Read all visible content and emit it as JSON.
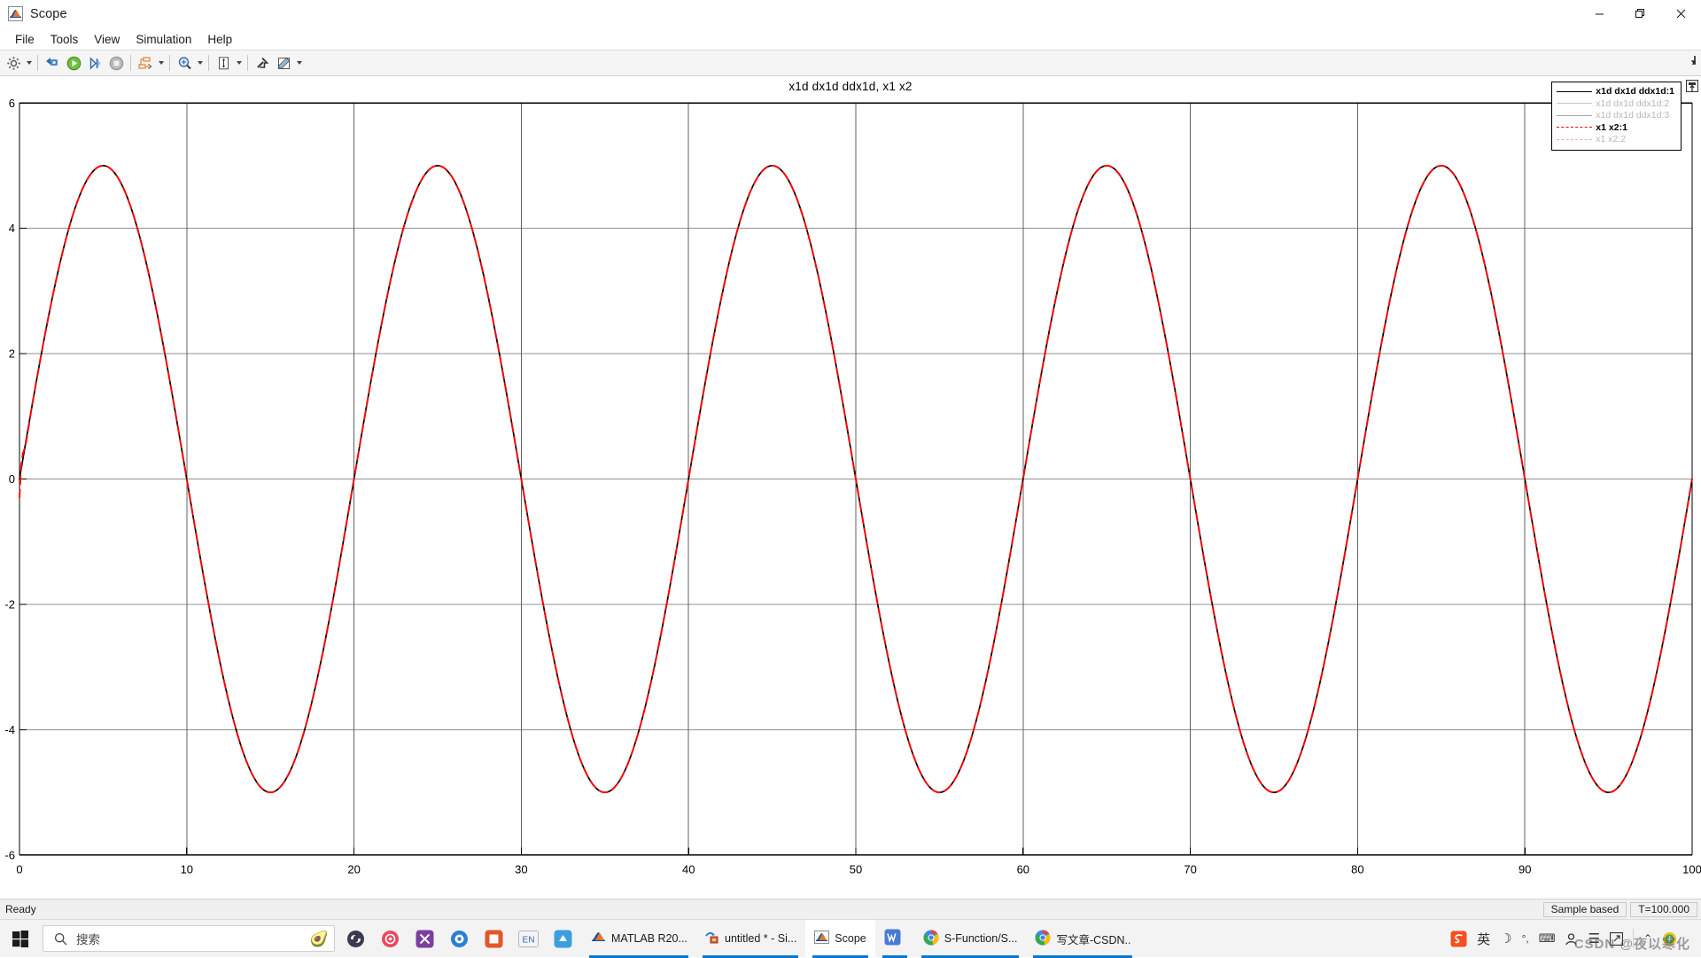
{
  "window": {
    "title": "Scope",
    "app_icon": "matlab-scope-icon",
    "controls": {
      "minimize": "minimize-icon",
      "restore": "restore-icon",
      "close": "close-icon"
    }
  },
  "menubar": {
    "items": [
      {
        "label": "File",
        "name": "menu-file"
      },
      {
        "label": "Tools",
        "name": "menu-tools"
      },
      {
        "label": "View",
        "name": "menu-view"
      },
      {
        "label": "Simulation",
        "name": "menu-simulation"
      },
      {
        "label": "Help",
        "name": "menu-help"
      }
    ]
  },
  "toolbar": {
    "buttons": [
      {
        "name": "configuration-properties-button",
        "icon": "gear-icon",
        "has_dropdown": true
      },
      {
        "name": "sim-restart-button",
        "icon": "rewind-camera-icon",
        "has_dropdown": false
      },
      {
        "name": "run-button",
        "icon": "play-icon",
        "has_dropdown": false
      },
      {
        "name": "step-forward-button",
        "icon": "step-forward-icon",
        "has_dropdown": false
      },
      {
        "name": "stop-button",
        "icon": "stop-icon",
        "has_dropdown": false
      },
      {
        "name": "signal-selection-button",
        "icon": "signal-selector-icon",
        "has_dropdown": true
      },
      {
        "name": "zoom-button",
        "icon": "zoom-in-icon",
        "has_dropdown": true
      },
      {
        "name": "autoscale-button",
        "icon": "autoscale-icon",
        "has_dropdown": true
      },
      {
        "name": "cursor-measurements-button",
        "icon": "cursor-measurement-icon",
        "has_dropdown": false
      },
      {
        "name": "style-button",
        "icon": "pencil-style-icon",
        "has_dropdown": true
      }
    ],
    "right_icon": "dock-arrow-icon"
  },
  "plot": {
    "title": "x1d   dx1d   ddx1d, x1 x2",
    "legend_icon": "legend-resize-icon"
  },
  "chart_data": {
    "type": "line",
    "title": "x1d   dx1d   ddx1d, x1 x2",
    "xlabel": "",
    "ylabel": "",
    "xlim": [
      0,
      100
    ],
    "ylim": [
      -6,
      6
    ],
    "xticks": [
      0,
      10,
      20,
      30,
      40,
      50,
      60,
      70,
      80,
      90,
      100
    ],
    "yticks": [
      -6,
      -4,
      -2,
      0,
      2,
      4,
      6
    ],
    "grid": true,
    "legend_position": "top-right",
    "legend": [
      {
        "label": "x1d   dx1d   ddx1d:1",
        "color": "#000000",
        "style": "solid",
        "width": 1.6,
        "visible": true
      },
      {
        "label": "x1d   dx1d   ddx1d:2",
        "color": "#c8c8c8",
        "style": "solid",
        "width": 1.2,
        "visible": false
      },
      {
        "label": "x1d   dx1d   ddx1d:3",
        "color": "#a6a6a6",
        "style": "solid",
        "width": 1.2,
        "visible": false
      },
      {
        "label": "x1 x2:1",
        "color": "#ff0000",
        "style": "dashed",
        "width": 1.8,
        "visible": true
      },
      {
        "label": "x1 x2:2",
        "color": "#ffaaaa",
        "style": "dashed",
        "width": 1.4,
        "visible": false
      }
    ],
    "series": [
      {
        "name": "x1d   dx1d   ddx1d:1",
        "color": "#000000",
        "style": "solid",
        "formula": "5*sin(2*pi*x/20)",
        "amplitude": 5,
        "period": 20,
        "phase": 0,
        "samples": 1001
      },
      {
        "name": "x1 x2:1",
        "color": "#ff0000",
        "style": "dashed",
        "formula": "5*sin(2*pi*x/20)",
        "amplitude": 5,
        "period": 20,
        "phase": 0,
        "samples": 1001,
        "startup_transient": true
      }
    ]
  },
  "statusbar": {
    "ready_text": "Ready",
    "sample_mode": "Sample based",
    "time": "T=100.000"
  },
  "taskbar": {
    "start_icon": "windows-start-icon",
    "search": {
      "placeholder": "搜索",
      "icon": "search-icon",
      "extra_icon": "avocado-icon"
    },
    "pinned": [
      {
        "name": "taskbar-icon-sogou-cloud",
        "glyph": "S"
      },
      {
        "name": "taskbar-icon-recorder",
        "glyph": "◉"
      },
      {
        "name": "taskbar-icon-app-purple",
        "glyph": "✕"
      },
      {
        "name": "taskbar-icon-app-blue",
        "glyph": "◍"
      },
      {
        "name": "taskbar-icon-app-orange",
        "glyph": "▣"
      },
      {
        "name": "taskbar-icon-ime-en",
        "glyph": "EN"
      },
      {
        "name": "taskbar-icon-app-cyan",
        "glyph": "⬡"
      }
    ],
    "windows": [
      {
        "name": "taskbar-window-matlab",
        "label": "MATLAB R20...",
        "icon": "matlab-icon",
        "active": false
      },
      {
        "name": "taskbar-window-simulink",
        "label": "untitled * - Si...",
        "icon": "simulink-icon",
        "active": false
      },
      {
        "name": "taskbar-window-scope",
        "label": "Scope",
        "icon": "scope-icon",
        "active": true
      },
      {
        "name": "taskbar-window-wps",
        "label": "",
        "icon": "wps-icon",
        "active": false
      },
      {
        "name": "taskbar-window-chrome-sfunction",
        "label": "S-Function/S...",
        "icon": "chrome-icon",
        "active": false
      },
      {
        "name": "taskbar-window-chrome-csdn",
        "label": "写文章-CSDN...",
        "icon": "chrome-icon",
        "active": false
      }
    ],
    "tray": [
      {
        "name": "tray-sogou-icon",
        "glyph": "S"
      },
      {
        "name": "tray-ime-chinese-icon",
        "glyph": "英"
      },
      {
        "name": "tray-moon-icon",
        "glyph": "☽"
      },
      {
        "name": "tray-punctuation-icon",
        "glyph": "°,"
      },
      {
        "name": "tray-keyboard-icon",
        "glyph": "⌨"
      },
      {
        "name": "tray-user-icon",
        "glyph": "👤"
      },
      {
        "name": "tray-menu-icon",
        "glyph": "☰"
      },
      {
        "name": "tray-toolbox-icon",
        "glyph": "⧉"
      }
    ],
    "overflow_icon": "chevron-up-icon",
    "notification_icon": "update-icon",
    "watermark": "CSDN @夜以寒化"
  }
}
